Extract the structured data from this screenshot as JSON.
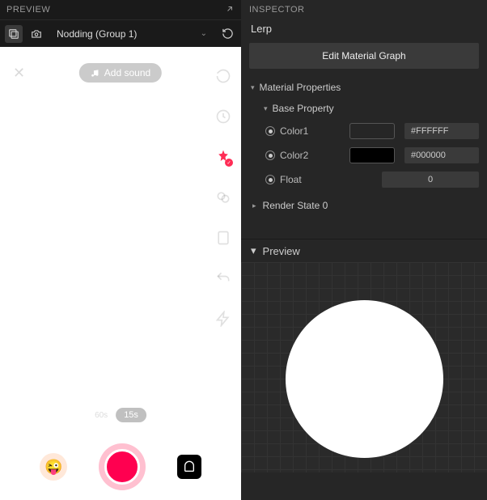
{
  "preview": {
    "title": "PREVIEW",
    "animation_name": "Nodding (Group 1)",
    "sound_button": "Add sound",
    "timer_60": "60s",
    "timer_15": "15s"
  },
  "inspector": {
    "title": "INSPECTOR",
    "node_name": "Lerp",
    "edit_button": "Edit Material Graph",
    "sections": {
      "material_properties": "Material Properties",
      "base_property": "Base Property",
      "render_state": "Render State 0",
      "preview": "Preview"
    },
    "properties": {
      "color1": {
        "label": "Color1",
        "swatch": "#FFFFFF",
        "hex": "#FFFFFF"
      },
      "color2": {
        "label": "Color2",
        "swatch": "#000000",
        "hex": "#000000"
      },
      "float": {
        "label": "Float",
        "value": "0"
      }
    }
  }
}
